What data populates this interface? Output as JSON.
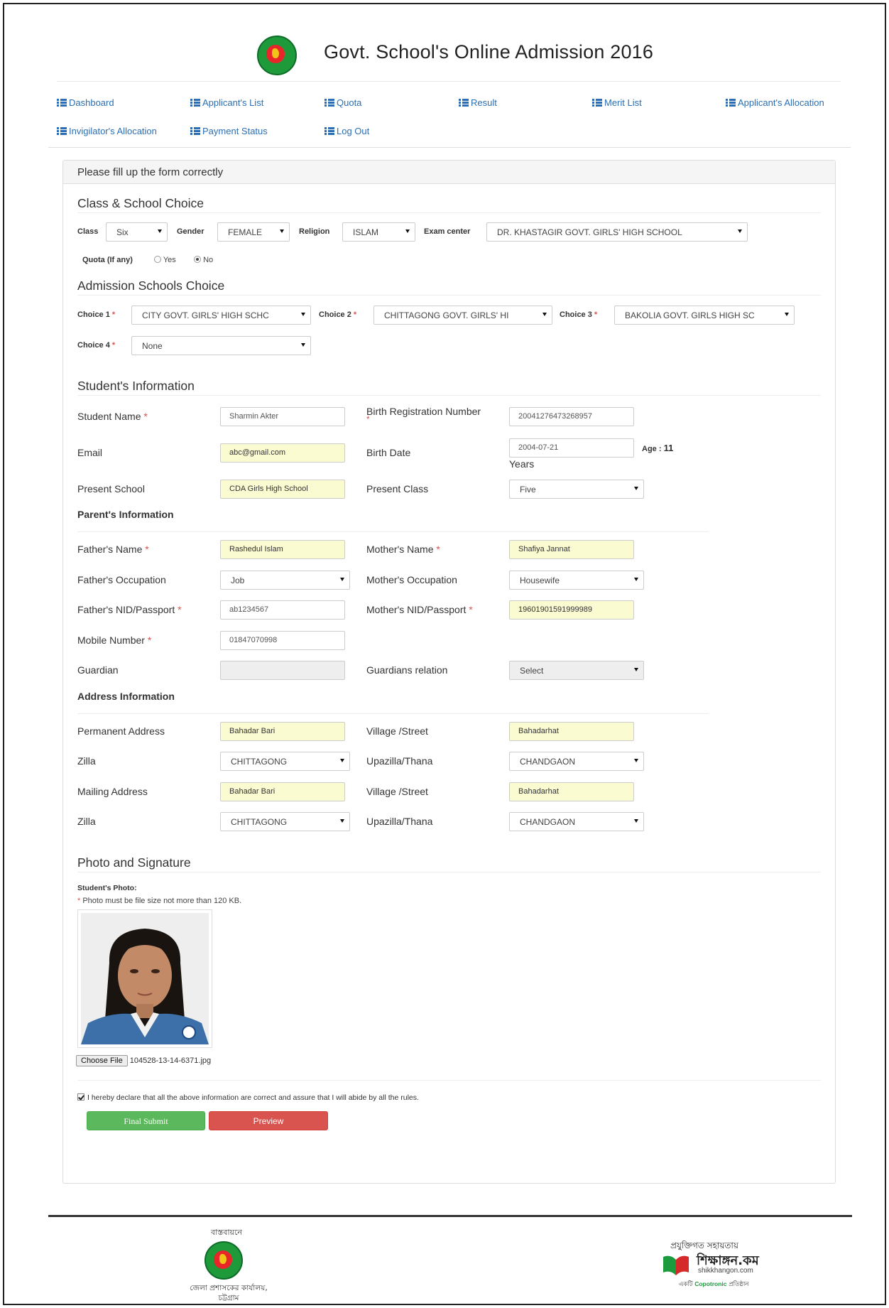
{
  "header": {
    "title": "Govt. School's Online Admission 2016"
  },
  "nav": [
    {
      "label": "Dashboard"
    },
    {
      "label": "Applicant's List"
    },
    {
      "label": "Quota"
    },
    {
      "label": "Result"
    },
    {
      "label": "Merit List"
    },
    {
      "label": "Applicant's Allocation"
    },
    {
      "label": "Invigilator's Allocation"
    },
    {
      "label": "Payment Status"
    },
    {
      "label": "Log Out"
    }
  ],
  "panel_title": "Please fill up the form correctly",
  "class_section": {
    "title": "Class & School Choice",
    "class_label": "Class",
    "class_value": "Six",
    "gender_label": "Gender",
    "gender_value": "FEMALE",
    "religion_label": "Religion",
    "religion_value": "ISLAM",
    "exam_center_label": "Exam center",
    "exam_center_value": "DR. KHASTAGIR GOVT. GIRLS' HIGH SCHOOL",
    "quota_label": "Quota (If any)",
    "quota_yes": "Yes",
    "quota_no": "No"
  },
  "schools_section": {
    "title": "Admission Schools Choice",
    "choice1_label": "Choice 1",
    "choice1_value": "CITY GOVT. GIRLS' HIGH SCHC",
    "choice2_label": "Choice 2",
    "choice2_value": "CHITTAGONG GOVT. GIRLS' HI",
    "choice3_label": "Choice 3",
    "choice3_value": "BAKOLIA GOVT. GIRLS HIGH SC",
    "choice4_label": "Choice 4",
    "choice4_value": "None",
    "required_mark": "*"
  },
  "student_section": {
    "title": "Student's Information",
    "name_label": "Student Name",
    "name_value": "Sharmin Akter",
    "birth_reg_label": "Birth Registration Number",
    "birth_reg_value": "20041276473268957",
    "email_label": "Email",
    "email_value": "abc@gmail.com",
    "birth_date_label": "Birth Date",
    "birth_date_value": "2004-07-21",
    "age_label": "Age :",
    "age_value": "11",
    "age_unit": "Years",
    "present_school_label": "Present School",
    "present_school_value": "CDA Girls High School",
    "present_class_label": "Present Class",
    "present_class_value": "Five"
  },
  "parent_section": {
    "title": "Parent's Information",
    "father_name_label": "Father's Name",
    "father_name_value": "Rashedul Islam",
    "mother_name_label": "Mother's Name",
    "mother_name_value": "Shafiya Jannat",
    "father_occ_label": "Father's Occupation",
    "father_occ_value": "Job",
    "mother_occ_label": "Mother's Occupation",
    "mother_occ_value": "Housewife",
    "father_nid_label": "Father's NID/Passport",
    "father_nid_value": "ab1234567",
    "mother_nid_label": "Mother's NID/Passport",
    "mother_nid_value": "19601901591999989",
    "mobile_label": "Mobile Number",
    "mobile_value": "01847070998",
    "guardian_label": "Guardian",
    "guardian_value": "",
    "guardian_rel_label": "Guardians relation",
    "guardian_rel_value": "Select"
  },
  "address_section": {
    "title": "Address Information",
    "perm_label": "Permanent Address",
    "perm_value": "Bahadar Bari",
    "perm_village_label": "Village /Street",
    "perm_village_value": "Bahadarhat",
    "perm_zilla_label": "Zilla",
    "perm_zilla_value": "CHITTAGONG",
    "perm_upazilla_label": "Upazilla/Thana",
    "perm_upazilla_value": "CHANDGAON",
    "mail_label": "Mailing Address",
    "mail_value": "Bahadar Bari",
    "mail_village_label": "Village /Street",
    "mail_village_value": "Bahadarhat",
    "mail_zilla_label": "Zilla",
    "mail_zilla_value": "CHITTAGONG",
    "mail_upazilla_label": "Upazilla/Thana",
    "mail_upazilla_value": "CHANDGAON"
  },
  "photo_section": {
    "title": "Photo and Signature",
    "photo_label": "Student's Photo:",
    "photo_note": "Photo must be file size not more than 120 KB.",
    "choose_file": "Choose File",
    "file_name": "104528-13-14-6371.jpg"
  },
  "declaration": "I hereby declare that all the above information are correct and assure that I will abide by all the rules.",
  "buttons": {
    "submit": "Final Submit",
    "preview": "Preview"
  },
  "footer": {
    "left_top": "বাস্তবায়নে",
    "left_bottom_1": "জেলা প্রশাসকের কার্যালয়,",
    "left_bottom_2": "চট্টগ্রাম",
    "right_top": "প্রযুক্তিগত সহায়তায়",
    "right_brand": "শিক্ষাঙ্গন.কম",
    "right_site": "shikkhangon.com",
    "right_tag_pre": "একটি",
    "right_tag_brand": "Copotronic",
    "right_tag_post": "প্রতিষ্ঠান"
  },
  "colors": {
    "link": "#2a6fb5",
    "required": "#d9534f",
    "highlight_input": "#fbfbd2",
    "submit": "#5cb85c",
    "preview": "#d9534f"
  }
}
